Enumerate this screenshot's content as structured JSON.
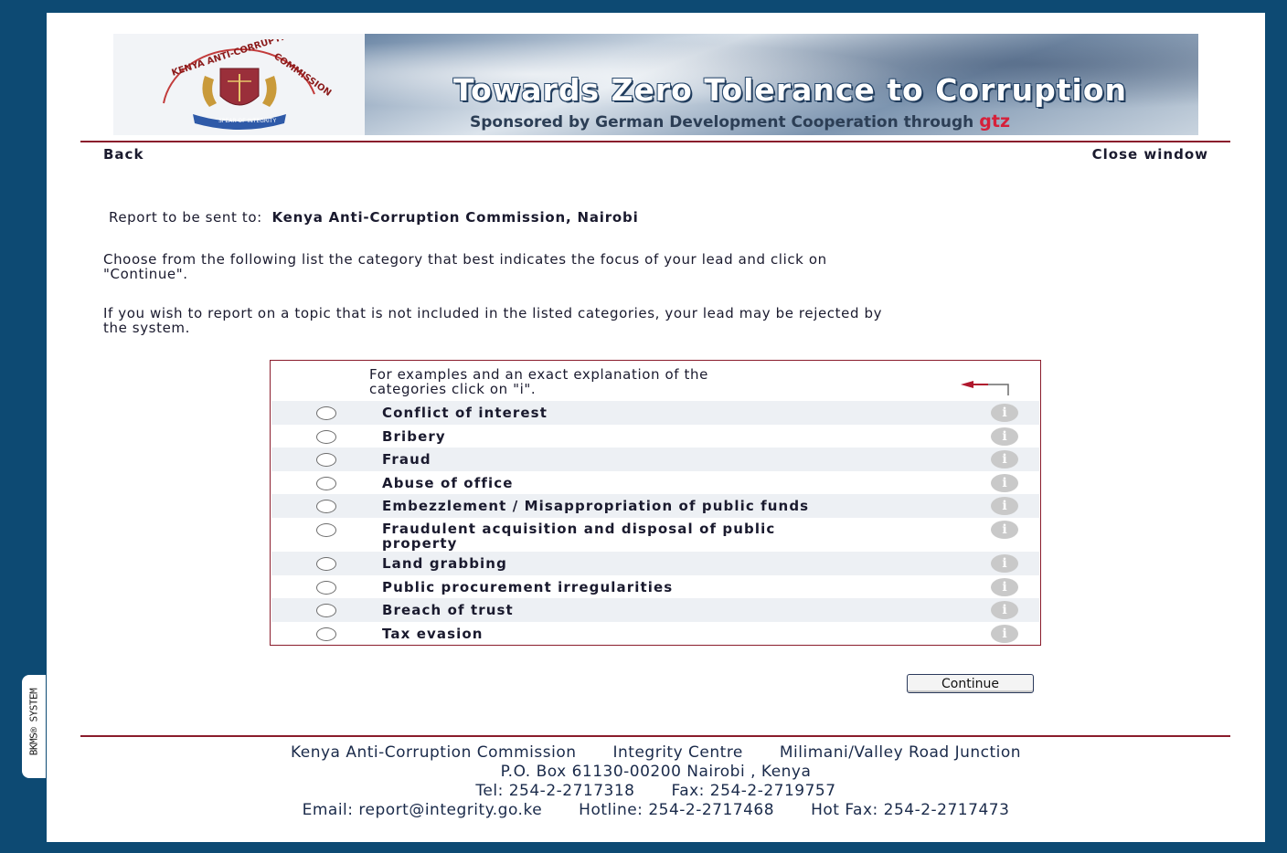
{
  "banner": {
    "headline": "Towards Zero Tolerance to Corruption",
    "sponsor": "Sponsored by German Development Cooperation through",
    "sponsor_brand": "gtz",
    "seal_top_text": "KENYA ANTI-CORRUPTION COMMISSION",
    "seal_motto": "SPEAR OF INTEGRITY"
  },
  "nav": {
    "back_label": "Back",
    "close_label": "Close window"
  },
  "recipient": {
    "prefix": "Report to be sent to:",
    "name": "Kenya Anti-Corruption Commission, Nairobi"
  },
  "instructions": {
    "line1": "Choose from the following list the category that best indicates the focus of your lead and click on",
    "line1b": "\"Continue\".",
    "line2": "If you wish to report on a topic that is not included in the listed categories, your lead may be rejected by",
    "line2b": "the system."
  },
  "categories": {
    "hint_line1": "For examples and an exact explanation of the",
    "hint_line2": "categories click on \"i\".",
    "info_glyph": "i",
    "items": [
      {
        "label": "Conflict of interest",
        "selected": false
      },
      {
        "label": "Bribery",
        "selected": false
      },
      {
        "label": "Fraud",
        "selected": false
      },
      {
        "label": "Abuse of office",
        "selected": false
      },
      {
        "label": "Embezzlement / Misappropriation of public funds",
        "selected": false
      },
      {
        "label": "Fraudulent acquisition and disposal of public",
        "label2": "property",
        "selected": false
      },
      {
        "label": "Land grabbing",
        "selected": false
      },
      {
        "label": "Public procurement irregularities",
        "selected": false
      },
      {
        "label": "Breach of trust",
        "selected": false
      },
      {
        "label": "Tax evasion",
        "selected": false
      }
    ]
  },
  "continue_label": "Continue",
  "footer": {
    "org": "Kenya Anti-Corruption Commission",
    "building": "Integrity Centre",
    "location": "Milimani/Valley Road Junction",
    "pobox": "P.O. Box 61130-00200 Nairobi , Kenya",
    "tel": "Tel: 254-2-2717318",
    "fax": "Fax: 254-2-2719757",
    "email": "Email: report@integrity.go.ke",
    "hotline": "Hotline: 254-2-2717468",
    "hotfax": "Hot Fax: 254-2-2717473"
  },
  "side_badge": "BKMS® SYSTEM",
  "colors": {
    "frame": "#0d4a73",
    "rule": "#8a1c2c",
    "row_stripe": "#edf0f4",
    "brand_red": "#d6203a"
  }
}
